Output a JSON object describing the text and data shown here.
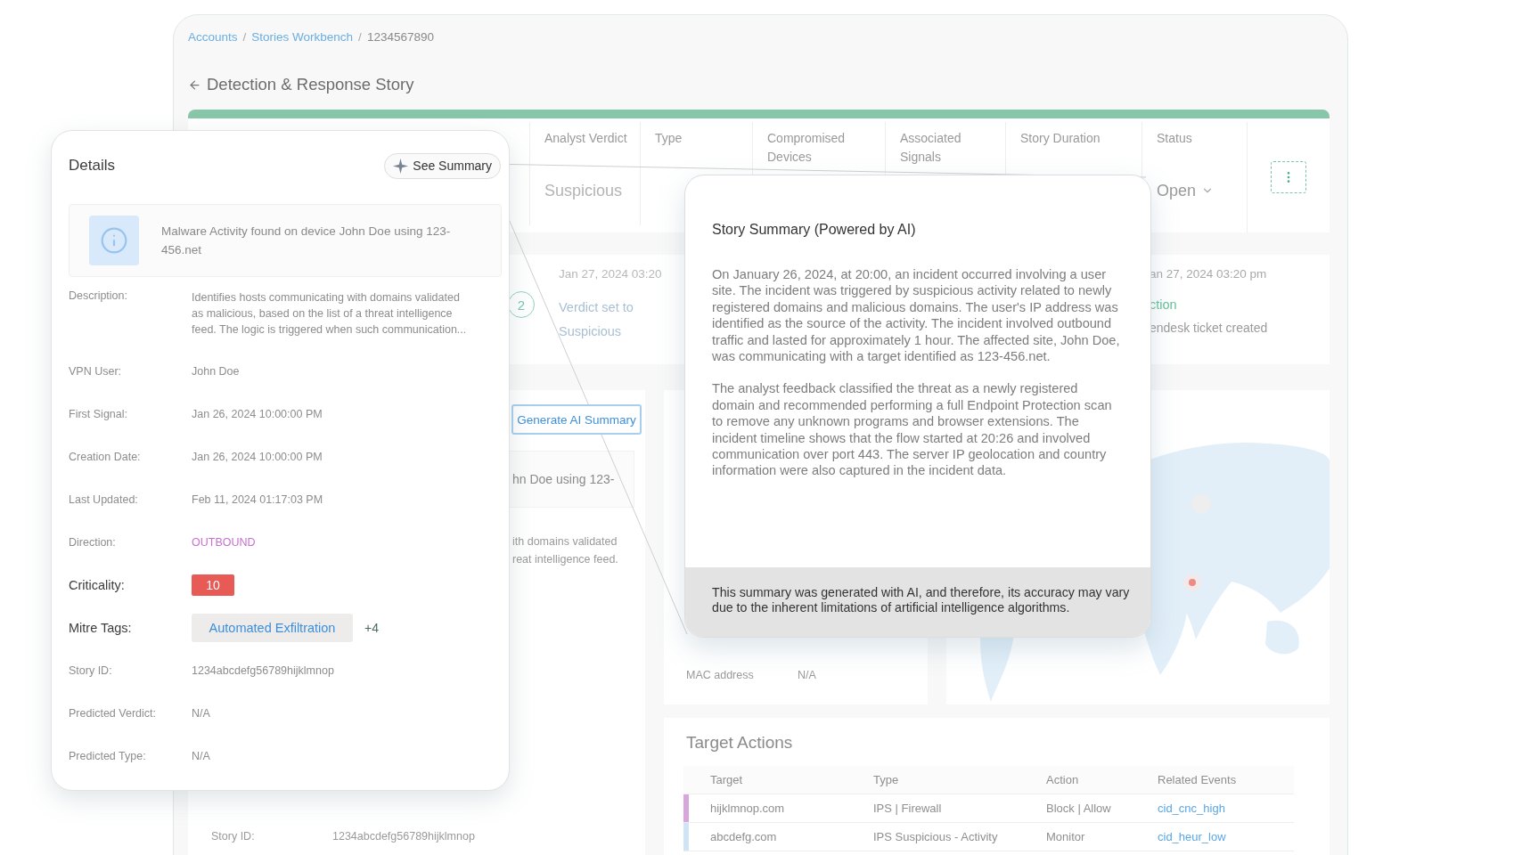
{
  "breadcrumb": {
    "separator": "/",
    "items": [
      {
        "label": "Accounts",
        "link": true
      },
      {
        "label": "Stories Workbench",
        "link": true
      },
      {
        "label": "1234567890",
        "link": false
      }
    ]
  },
  "page_title": "Detection & Response Story",
  "story_header": {
    "columns": [
      {
        "label": "Analyst Verdict",
        "value": "Suspicious",
        "kind": "text"
      },
      {
        "label": "Type",
        "kind": "empty"
      },
      {
        "label": "Compromised Devices",
        "kind": "empty"
      },
      {
        "label": "Associated Signals",
        "kind": "empty"
      },
      {
        "label": "Story Duration",
        "kind": "empty"
      },
      {
        "label": "Status",
        "value": "Open",
        "kind": "dropdown"
      }
    ]
  },
  "timeline": {
    "step_event": {
      "step": "2",
      "date": "Jan 27, 2024 03:20",
      "lines": [
        "Verdict set to",
        "Suspicious"
      ]
    },
    "action_event": {
      "date": "an 27, 2024 03:20 pm",
      "action": "ction",
      "note": "endesk ticket created"
    }
  },
  "story_card": {
    "button": "Generate AI Summary",
    "message": "hn Doe using 123-",
    "description": [
      "ith domains validated",
      "reat intelligence feed."
    ],
    "field": {
      "label": "Story ID:",
      "value": "1234abcdefg56789hijklmnop"
    }
  },
  "device_card": {
    "field": {
      "label": "MAC address",
      "value": "N/A"
    }
  },
  "target_actions": {
    "title": "Target Actions",
    "columns": [
      {
        "label": "Target",
        "kind": "text"
      },
      {
        "label": "Type",
        "kind": "text"
      },
      {
        "label": "Action",
        "kind": "text"
      },
      {
        "label": "Related Events",
        "kind": "link"
      }
    ],
    "rows": [
      {
        "cells": [
          "hijklmnop.com",
          "IPS | Firewall",
          "Block | Allow",
          "cid_cnc_high"
        ],
        "color": "#d8a6dc"
      },
      {
        "cells": [
          "abcdefg.com",
          "IPS Suspicious - Activity",
          "Monitor",
          "cid_heur_low"
        ],
        "color": "#cfe4f6"
      }
    ]
  },
  "details": {
    "title": "Details",
    "summary_button": "See Summary",
    "alert": "Malware Activity found on device John Doe using 123-456.net",
    "fields": [
      {
        "label": "Description:",
        "value": "Identifies hosts communicating with domains validated as malicious, based on the list of a threat intelligence feed. The logic is triggered when such communication...",
        "kind": "text"
      },
      {
        "label": "VPN User:",
        "value": "John Doe",
        "kind": "text"
      },
      {
        "label": "First Signal:",
        "value": "Jan 26, 2024 10:00:00 PM",
        "kind": "text"
      },
      {
        "label": "Creation Date:",
        "value": "Jan 26, 2024 10:00:00 PM",
        "kind": "text"
      },
      {
        "label": "Last Updated:",
        "value": "Feb 11, 2024 01:17:03 PM",
        "kind": "text"
      },
      {
        "label": "Direction:",
        "value": "OUTBOUND",
        "kind": "direction"
      },
      {
        "label": "Criticality:",
        "value": "10",
        "kind": "badge"
      },
      {
        "label": "Mitre Tags:",
        "value": "Automated Exfiltration",
        "more": "+4",
        "kind": "tag"
      },
      {
        "label": "Story ID:",
        "value": "1234abcdefg56789hijklmnop",
        "kind": "text"
      },
      {
        "label": "Predicted Verdict:",
        "value": "N/A",
        "kind": "text"
      },
      {
        "label": "Predicted Type:",
        "value": "N/A",
        "kind": "text"
      }
    ]
  },
  "summary_popup": {
    "title": "Story Summary (Powered by AI)",
    "paragraphs": [
      "On January 26, 2024, at 20:00, an incident occurred involving a user site. The incident was triggered by suspicious activity related to newly registered domains and malicious domains. The user's IP address was identified as the source of the activity. The incident involved outbound traffic and lasted for approximately 1 hour. The affected site, John Doe, was communicating with a target identified as 123-456.net.",
      "The analyst feedback classified the threat as a newly registered domain and recommended performing a full Endpoint Protection scan to remove any unknown programs and browser extensions. The incident timeline shows that the flow started at 20:26 and involved communication over port 443. The server IP geolocation and country information were also captured in the incident data."
    ],
    "disclaimer": "This summary was generated with AI, and therefore, its accuracy may vary due to the inherent limitations of artificial intelligence algorithms."
  }
}
